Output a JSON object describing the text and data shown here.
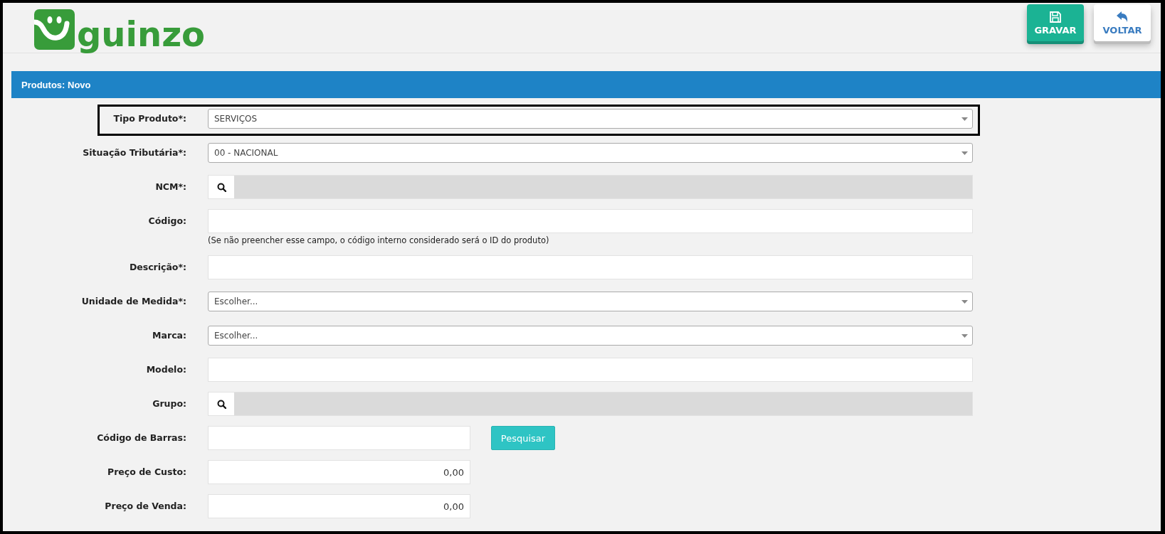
{
  "header": {
    "logo": "guinzo",
    "buttons": [
      {
        "kind": "save",
        "label": "GRAVAR"
      },
      {
        "kind": "back",
        "label": "VOLTAR"
      }
    ]
  },
  "panel": {
    "title": "Produtos: Novo"
  },
  "fields": [
    {
      "kind": "select",
      "label": "Tipo Produto*:",
      "value": "SERVIÇOS",
      "highlighted": true
    },
    {
      "kind": "select",
      "label": "Situação Tributária*:",
      "value": "00 - NACIONAL",
      "highlighted": false
    },
    {
      "kind": "lookup",
      "label": "NCM*:",
      "highlighted": false
    },
    {
      "kind": "text",
      "label": "Código:",
      "note": "(Se não preencher esse campo, o código interno considerado será o ID do produto)",
      "highlighted": false
    },
    {
      "kind": "text",
      "label": "Descrição*:",
      "highlighted": false
    },
    {
      "kind": "select",
      "label": "Unidade de Medida*:",
      "value": "Escolher...",
      "highlighted": false
    },
    {
      "kind": "select",
      "label": "Marca:",
      "value": "Escolher...",
      "highlighted": false
    },
    {
      "kind": "text",
      "label": "Modelo:",
      "highlighted": false
    },
    {
      "kind": "lookup",
      "label": "Grupo:",
      "highlighted": false
    },
    {
      "kind": "barcode",
      "label": "Código de Barras:",
      "button": "Pesquisar",
      "highlighted": false
    },
    {
      "kind": "number",
      "label": "Preço de Custo:",
      "value": "0,00",
      "highlighted": false
    },
    {
      "kind": "number",
      "label": "Preço de Venda:",
      "value": "0,00",
      "highlighted": false
    }
  ]
}
